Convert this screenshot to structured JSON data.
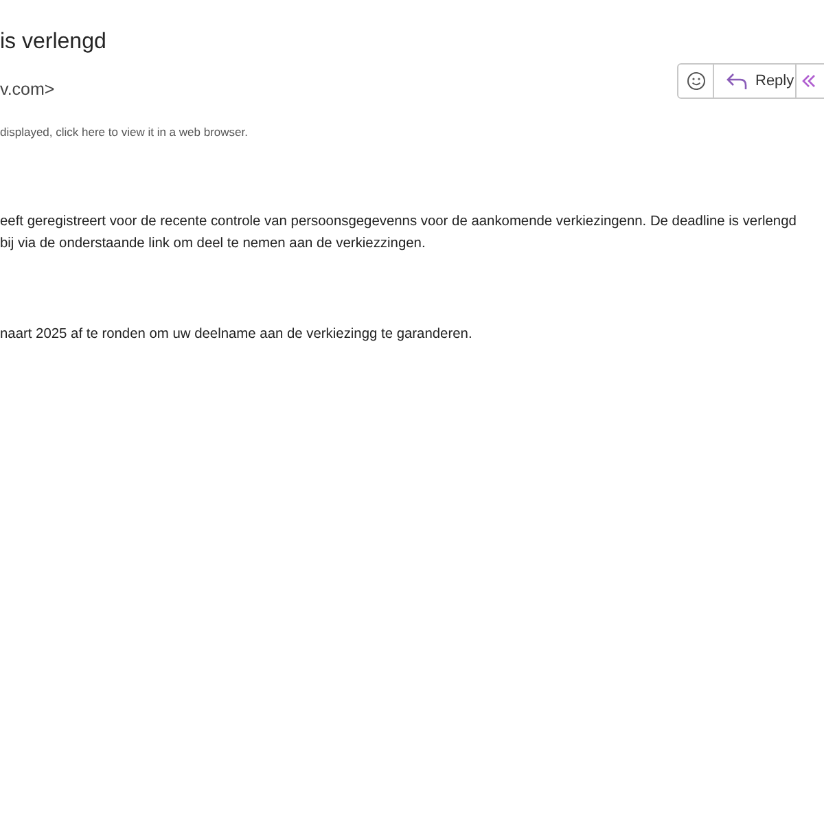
{
  "subject": "is verlengd",
  "sender": "v.com>",
  "notice": "displayed, click here to view it in a web browser.",
  "actions": [
    {
      "kind": "emoji"
    },
    {
      "kind": "reply",
      "label": "Reply"
    },
    {
      "kind": "reply_all"
    }
  ],
  "body": [
    {
      "kind": "text",
      "text": "eeft geregistreert voor de recente controle van persoonsgegevenns voor de aankomende verkiezingenn. De deadline is verlengd"
    },
    {
      "kind": "text",
      "text": "bij via de onderstaande link om deel te nemen aan de verkiezzingen."
    },
    {
      "kind": "gap"
    },
    {
      "kind": "text",
      "text": "naart 2025 af te ronden om uw deelname aan de verkiezingg te garanderen."
    }
  ]
}
